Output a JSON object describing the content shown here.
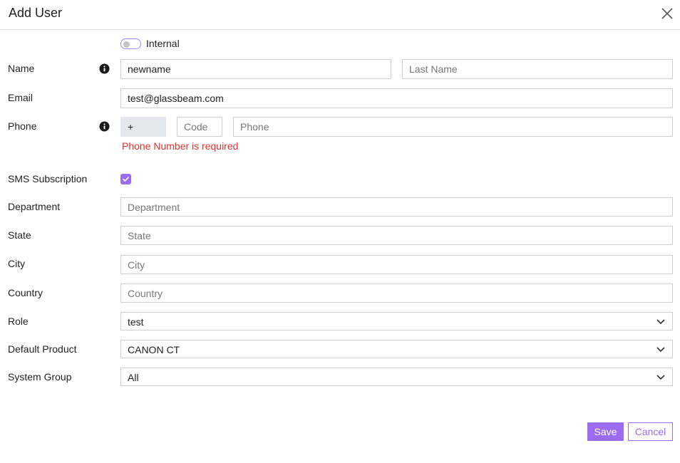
{
  "dialog": {
    "title": "Add User"
  },
  "form": {
    "internal_label": "Internal",
    "name": {
      "label": "Name",
      "first_value": "newname",
      "last_placeholder": "Last Name"
    },
    "email": {
      "label": "Email",
      "value": "test@glassbeam.com"
    },
    "phone": {
      "label": "Phone",
      "prefix": "+",
      "code_placeholder": "Code",
      "number_placeholder": "Phone",
      "error": "Phone Number is required"
    },
    "sms": {
      "label": "SMS Subscription",
      "checked": true
    },
    "department": {
      "label": "Department",
      "placeholder": "Department"
    },
    "state": {
      "label": "State",
      "placeholder": "State"
    },
    "city": {
      "label": "City",
      "placeholder": "City"
    },
    "country": {
      "label": "Country",
      "placeholder": "Country"
    },
    "role": {
      "label": "Role",
      "value": "test"
    },
    "default_product": {
      "label": "Default Product",
      "value": "CANON CT"
    },
    "system_group": {
      "label": "System Group",
      "value": "All"
    }
  },
  "footer": {
    "save_label": "Save",
    "cancel_label": "Cancel"
  },
  "colors": {
    "accent": "#9b6cf0",
    "error": "#e03030",
    "border": "#cfcfcf"
  }
}
